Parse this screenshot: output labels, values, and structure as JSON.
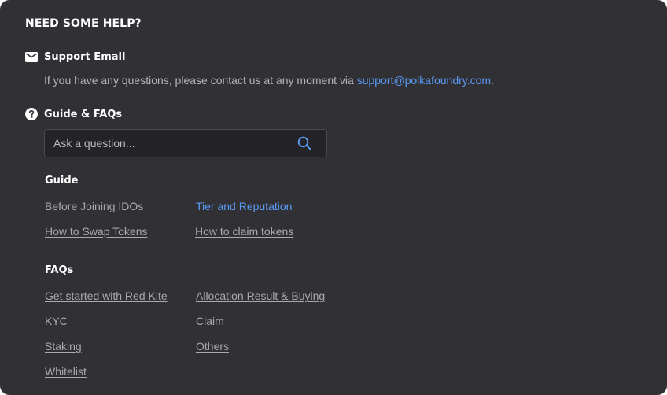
{
  "panel": {
    "title": "NEED SOME HELP?"
  },
  "support": {
    "heading": "Support Email",
    "icon": "envelope-icon",
    "text": "If you have any questions, please contact us at any moment via ",
    "email": "support@polkafoundry.com",
    "suffix": "."
  },
  "faq_section": {
    "heading": "Guide & FAQs",
    "icon": "question-circle-icon"
  },
  "search": {
    "placeholder": "Ask a question...",
    "value": "",
    "icon": "search-icon"
  },
  "guide": {
    "title": "Guide",
    "links": [
      "Before Joining IDOs",
      "Tier and Reputation",
      "How to Swap Tokens",
      "How to claim tokens"
    ],
    "active_link": "Tier and Reputation"
  },
  "faqs": {
    "title": "FAQs",
    "links": [
      "Get started with Red Kite",
      "Allocation Result & Buying",
      "KYC",
      "Claim",
      "Staking",
      "Others",
      "Whitelist"
    ]
  },
  "colors": {
    "panel_bg": "#303035",
    "link_accent": "#5c9cf5",
    "link_muted": "#a9a9ae",
    "text_muted": "#b5b5bb"
  }
}
